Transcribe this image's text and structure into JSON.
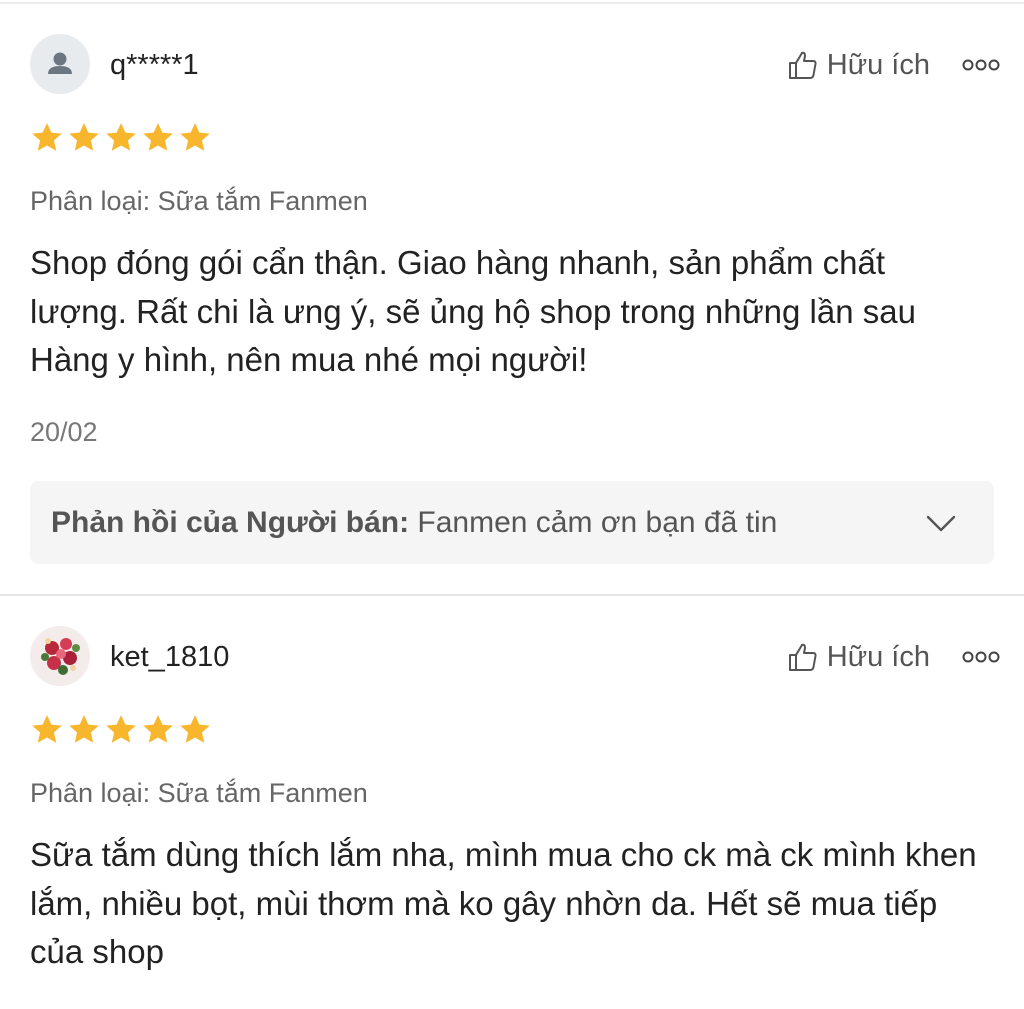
{
  "reviews": [
    {
      "username": "q*****1",
      "helpful_label": "Hữu ích",
      "rating": 5,
      "variant": "Phân loại: Sữa tắm Fanmen",
      "content": "Shop đóng gói cẩn thận. Giao hàng nhanh, sản phẩm chất lượng. Rất chi là ưng ý, sẽ ủng hộ shop trong những lần sau Hàng y hình, nên mua nhé mọi người!",
      "date": "20/02",
      "seller_reply": {
        "label": "Phản hồi của Người bán:",
        "text": "Fanmen cảm ơn bạn đã tin"
      }
    },
    {
      "username": "ket_1810",
      "helpful_label": "Hữu ích",
      "rating": 5,
      "variant": "Phân loại: Sữa tắm Fanmen",
      "content": "Sữa tắm dùng thích lắm nha, mình mua cho ck mà ck mình khen lắm, nhiều bọt, mùi thơm mà ko gây nhờn da. Hết sẽ mua tiếp của shop"
    }
  ],
  "icons": {
    "avatar_default": "user-silhouette-icon",
    "helpful": "thumbs-up-icon",
    "more": "more-options-icon",
    "star": "star-icon",
    "reply_toggle": "chevron-down-icon"
  },
  "colors": {
    "star": "#F8B62D",
    "text_primary": "#222222",
    "text_secondary": "#666666",
    "reply_bg": "#F5F5F5"
  }
}
